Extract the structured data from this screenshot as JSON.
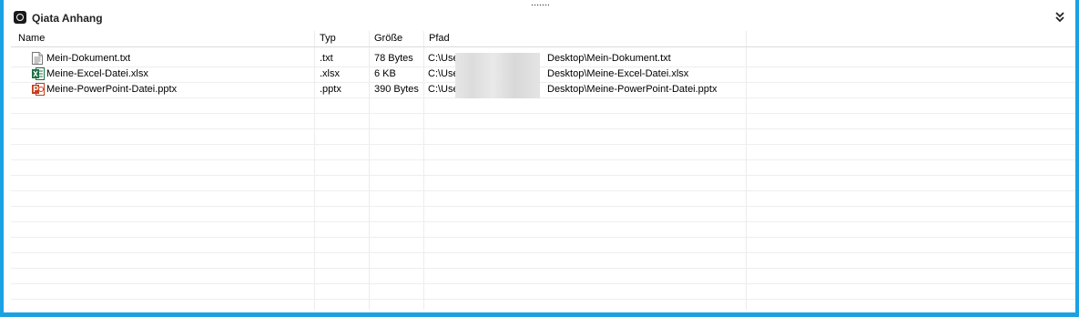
{
  "app": {
    "title": "Qiata Anhang"
  },
  "icons": {
    "logo": "qiata-logo-icon",
    "collapse": "double-chevron-down-icon"
  },
  "columns": [
    {
      "key": "name",
      "label": "Name"
    },
    {
      "key": "typ",
      "label": "Typ"
    },
    {
      "key": "groesse",
      "label": "Größe"
    },
    {
      "key": "pfad",
      "label": "Pfad"
    }
  ],
  "files": [
    {
      "name": "Mein-Dokument.txt",
      "typ": ".txt",
      "groesse": "78 Bytes",
      "pfad_prefix": "C:\\Users",
      "pfad_suffix": "Desktop\\Mein-Dokument.txt",
      "icon": "text-file-icon"
    },
    {
      "name": "Meine-Excel-Datei.xlsx",
      "typ": ".xlsx",
      "groesse": "6 KB",
      "pfad_prefix": "C:\\Users",
      "pfad_suffix": "Desktop\\Meine-Excel-Datei.xlsx",
      "icon": "excel-file-icon"
    },
    {
      "name": "Meine-PowerPoint-Datei.pptx",
      "typ": ".pptx",
      "groesse": "390 Bytes",
      "pfad_prefix": "C:\\Users",
      "pfad_suffix": "Desktop\\Meine-PowerPoint-Datei.pptx",
      "icon": "powerpoint-file-icon"
    }
  ],
  "colors": {
    "frame": "#1ba1e2",
    "excel": "#1d7044",
    "powerpoint": "#c43e1c"
  }
}
